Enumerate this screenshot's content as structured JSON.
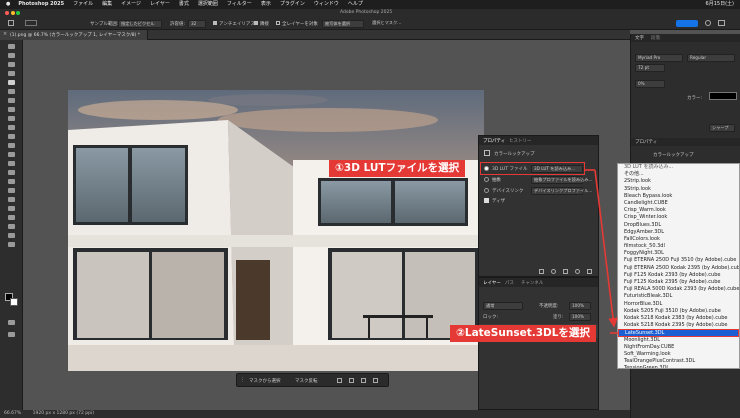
{
  "menubar": {
    "items": [
      "Photoshop 2025",
      "ファイル",
      "編集",
      "イメージ",
      "レイヤー",
      "書式",
      "選択範囲",
      "フィルター",
      "表示",
      "プラグイン",
      "ウィンドウ",
      "ヘルプ"
    ],
    "clock": "6月15日(土)"
  },
  "window": {
    "title": "Adobe Photoshop 2025"
  },
  "options_bar": {
    "sample_size_label": "サンプル範囲:",
    "sample_size_value": "指定したピクセル",
    "tolerance_label": "許容値:",
    "tolerance_value": "32",
    "antialias_label": "アンチエイリアス",
    "contiguous_label": "隣接",
    "all_layers_label": "全レイヤーを対象",
    "select_subject_label": "被写体を選択",
    "select_mask_label": "選択とマスク..."
  },
  "document_tab": {
    "title": "(1).png @ 66.7% (カラールックアップ 1, レイヤーマスク/8) *"
  },
  "statusbar": {
    "zoom": "66.67%",
    "size": "1920 px x 1280 px (72 ppi)"
  },
  "taskbar": {
    "mask_select_label": "マスクから選択",
    "mask_invert_label": "マスク反転"
  },
  "properties_panel": {
    "tab_properties": "プロパティ",
    "tab_history": "ヒストリー",
    "adjustment_title": "カラールックアップ",
    "row1_label": "3D LUT ファイル",
    "row1_value": "3D LUT を読み込み...",
    "row2_label": "抽象",
    "row2_value": "抽象プロファイルを読み込み...",
    "row3_label": "デバイスリンク",
    "row3_value": "デバイスリンクプロファイル...",
    "dither_label": "ディザ"
  },
  "layers_panel": {
    "tab_layers": "レイヤー",
    "tab_paths": "パス",
    "tab_channels": "チャンネル",
    "blend_mode": "通常",
    "opacity_label": "不透明度:",
    "opacity_value": "100%",
    "lock_label": "ロック:",
    "fill_label": "塗り:",
    "fill_value": "100%"
  },
  "right_panels": {
    "char_tab": "文字",
    "para_tab": "段落",
    "font": "Myriad Pro",
    "style": "Regular",
    "size": "72 pt",
    "color_label": "カラー:",
    "tracking": "0%",
    "properties_tab": "プロパティ",
    "properties_sub": "カラールックアップ",
    "sharp_label": "シャープ"
  },
  "dropdown": {
    "header": "3D LUT を読み込み...",
    "items": [
      "その他...",
      "2Strip.look",
      "3Strip.look",
      "Bleach Bypass.look",
      "Candlelight.CUBE",
      "Crisp_Warm.look",
      "Crisp_Winter.look",
      "DropBlues.3DL",
      "EdgyAmber.3DL",
      "FallColors.look",
      "filmstock_50.3dl",
      "FoggyNight.3DL",
      "Fuji ETERNA 250D Fuji 3510 (by Adobe).cube",
      "Fuji ETERNA 250D Kodak 2395 (by Adobe).cube",
      "Fuji F125 Kodak 2393 (by Adobe).cube",
      "Fuji F125 Kodak 2395 (by Adobe).cube",
      "Fuji REALA 500D Kodak 2393 (by Adobe).cube",
      "FuturisticBleak.3DL",
      "HorrorBlue.3DL",
      "Kodak 5205 Fuji 3510 (by Adobe).cube",
      "Kodak 5218 Kodak 2383 (by Adobe).cube",
      "Kodak 5218 Kodak 2395 (by Adobe).cube",
      "LateSunset.3DL",
      "Moonlight.3DL",
      "NightFromDay.CUBE",
      "Soft_Warming.look",
      "TealOrangePlusContrast.3DL",
      "TensionGreen.3DL"
    ],
    "selected_index": 22
  },
  "annotations": {
    "step1": "①3D LUTファイルを選択",
    "step2": "②LateSunset.3DLを選択"
  },
  "colors": {
    "accent": "#1b5fd2",
    "callout": "#e53935",
    "panel": "#323232",
    "workspace": "#535353"
  }
}
